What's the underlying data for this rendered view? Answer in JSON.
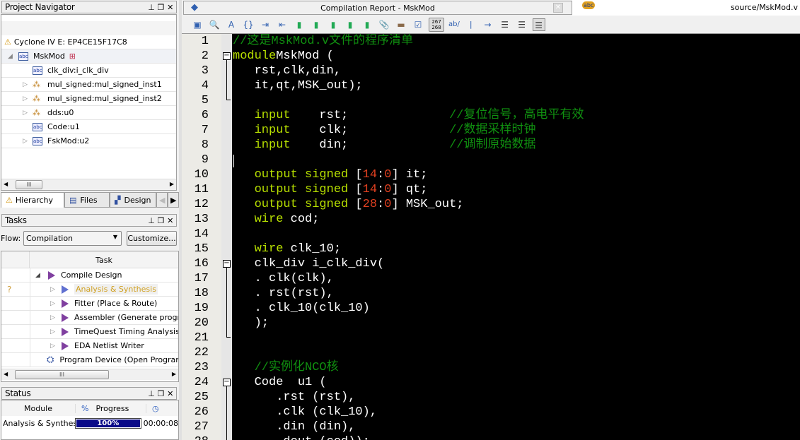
{
  "navigator": {
    "title": "Project Navigator",
    "device": "Cyclone IV E: EP4CE15F17C8",
    "top": "MskMod",
    "items": [
      {
        "label": "clk_div:i_clk_div",
        "icon": "abc",
        "exp": false
      },
      {
        "label": "mul_signed:mul_signed_inst1",
        "icon": "wand",
        "exp": true
      },
      {
        "label": "mul_signed:mul_signed_inst2",
        "icon": "wand",
        "exp": true
      },
      {
        "label": "dds:u0",
        "icon": "wand",
        "exp": true
      },
      {
        "label": "Code:u1",
        "icon": "abc",
        "exp": false
      },
      {
        "label": "FskMod:u2",
        "icon": "abc",
        "exp": true
      }
    ],
    "tabs": [
      "Hierarchy",
      "Files",
      "Design"
    ]
  },
  "tasks": {
    "title": "Tasks",
    "flow_label": "Flow:",
    "flow_value": "Compilation",
    "customize": "Customize...",
    "col": "Task",
    "question": "?",
    "items": [
      {
        "label": "Compile Design"
      },
      {
        "label": "Analysis & Synthesis"
      },
      {
        "label": "Fitter (Place & Route)"
      },
      {
        "label": "Assembler (Generate programming files)"
      },
      {
        "label": "TimeQuest Timing Analysis"
      },
      {
        "label": "EDA Netlist Writer"
      },
      {
        "label": "Program Device (Open Programmer)"
      }
    ]
  },
  "status": {
    "title": "Status",
    "col_module": "Module",
    "col_pct": "%",
    "col_progress": "Progress",
    "module": "Analysis & Synthesis",
    "progress": "100%",
    "progress_value": 100,
    "time": "00:00:08"
  },
  "tabs": {
    "report": "Compilation Report - MskMod",
    "source": "source/MskMod.v"
  },
  "toolbar": {
    "linenum": "267\n268",
    "ab": "ab/"
  },
  "code": [
    {
      "n": "1",
      "t": [
        [
          "cm",
          "//这是MskMod.v文件的程序清单"
        ]
      ]
    },
    {
      "n": "2",
      "f": "box",
      "t": [
        [
          "kw",
          "module"
        ],
        [
          "",
          "MskMod ("
        ]
      ]
    },
    {
      "n": "3",
      "t": [
        [
          "",
          "   rst,clk,din,"
        ]
      ]
    },
    {
      "n": "4",
      "t": [
        [
          "",
          "   it,qt,MSK_out);"
        ]
      ]
    },
    {
      "n": "5",
      "t": []
    },
    {
      "n": "6",
      "t": [
        [
          "kw",
          "   input"
        ],
        [
          "",
          "    rst;              "
        ],
        [
          "cm",
          "//复位信号，高电平有效"
        ]
      ]
    },
    {
      "n": "7",
      "t": [
        [
          "kw",
          "   input"
        ],
        [
          "",
          "    clk;              "
        ],
        [
          "cm",
          "//数据采样时钟"
        ]
      ]
    },
    {
      "n": "8",
      "t": [
        [
          "kw",
          "   input"
        ],
        [
          "",
          "    din;              "
        ],
        [
          "cm",
          "//调制原始数据"
        ]
      ]
    },
    {
      "n": "9",
      "t": []
    },
    {
      "n": "10",
      "t": [
        [
          "kw",
          "   output signed"
        ],
        [
          "",
          " ["
        ],
        [
          "num",
          "14"
        ],
        [
          "",
          ":"
        ],
        [
          "num",
          "0"
        ],
        [
          "",
          "] it;"
        ]
      ]
    },
    {
      "n": "11",
      "t": [
        [
          "kw",
          "   output signed"
        ],
        [
          "",
          " ["
        ],
        [
          "num",
          "14"
        ],
        [
          "",
          ":"
        ],
        [
          "num",
          "0"
        ],
        [
          "",
          "] qt;"
        ]
      ]
    },
    {
      "n": "12",
      "t": [
        [
          "kw",
          "   output signed"
        ],
        [
          "",
          " ["
        ],
        [
          "num",
          "28"
        ],
        [
          "",
          ":"
        ],
        [
          "num",
          "0"
        ],
        [
          "",
          "] MSK_out;"
        ]
      ]
    },
    {
      "n": "13",
      "t": [
        [
          "kw",
          "   wire"
        ],
        [
          "",
          " cod;"
        ]
      ]
    },
    {
      "n": "14",
      "t": []
    },
    {
      "n": "15",
      "t": [
        [
          "kw",
          "   wire"
        ],
        [
          "",
          " clk_10;"
        ]
      ]
    },
    {
      "n": "16",
      "f": "box",
      "t": [
        [
          "",
          "   clk_div i_clk_div("
        ]
      ]
    },
    {
      "n": "17",
      "t": [
        [
          "",
          "   . clk(clk),"
        ]
      ]
    },
    {
      "n": "18",
      "t": [
        [
          "",
          "   . rst(rst),"
        ]
      ]
    },
    {
      "n": "19",
      "t": [
        [
          "",
          "   . clk_10(clk_10)"
        ]
      ]
    },
    {
      "n": "20",
      "t": [
        [
          "",
          "   );"
        ]
      ]
    },
    {
      "n": "21",
      "t": []
    },
    {
      "n": "22",
      "t": []
    },
    {
      "n": "23",
      "t": [
        [
          "cm",
          "   //实例化NCO核"
        ]
      ]
    },
    {
      "n": "24",
      "f": "box",
      "t": [
        [
          "",
          "   Code  u1 ("
        ]
      ]
    },
    {
      "n": "25",
      "t": [
        [
          "",
          "      .rst (rst),"
        ]
      ]
    },
    {
      "n": "26",
      "t": [
        [
          "",
          "      .clk (clk_10),"
        ]
      ]
    },
    {
      "n": "27",
      "t": [
        [
          "",
          "      .din (din),"
        ]
      ]
    },
    {
      "n": "28",
      "t": [
        [
          "",
          "      .dout (cod));"
        ]
      ]
    }
  ]
}
